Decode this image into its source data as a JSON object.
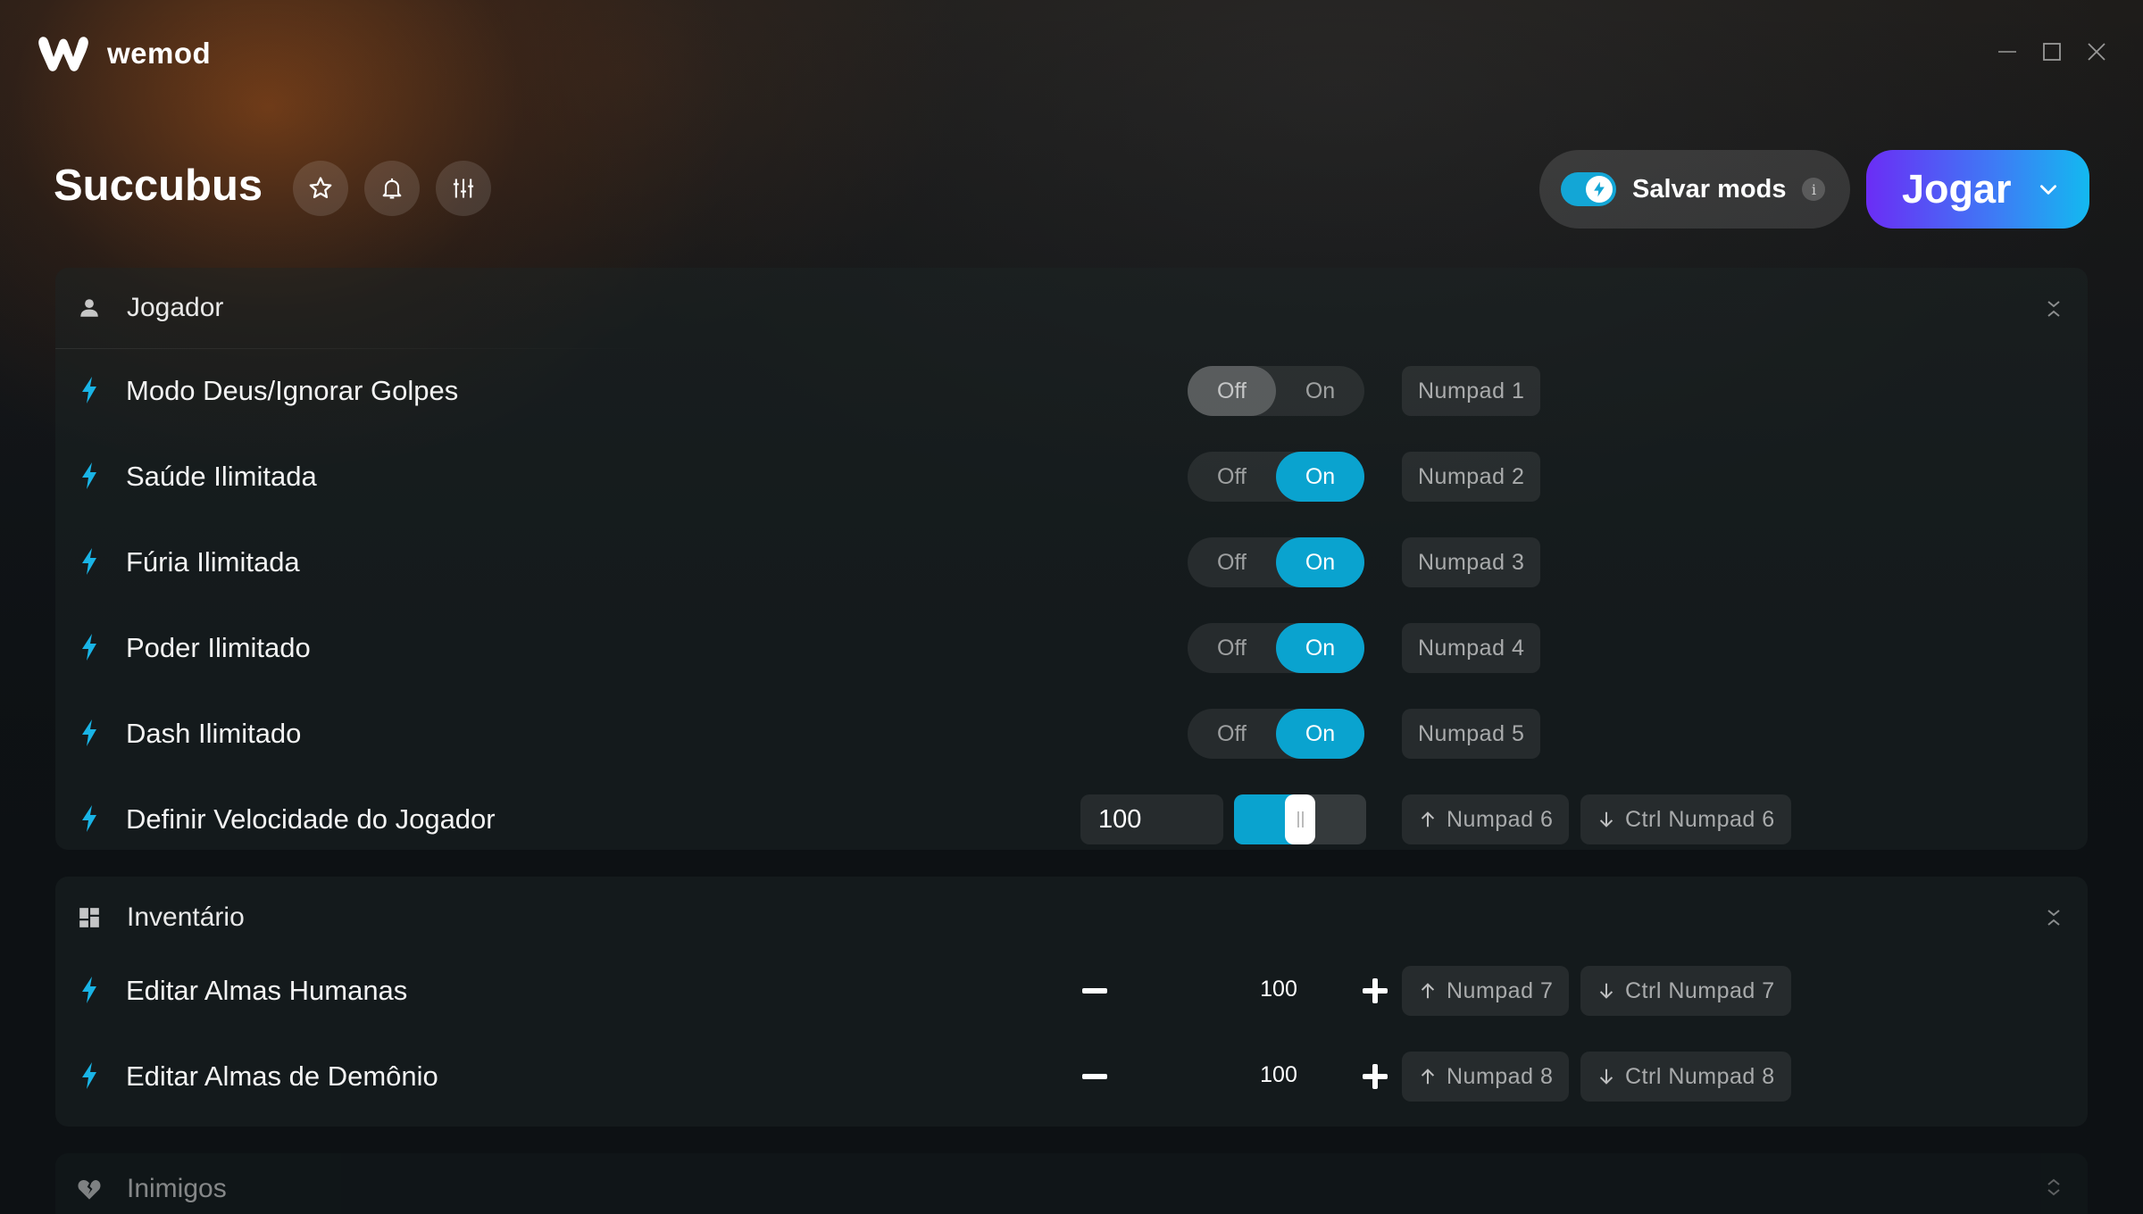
{
  "app": {
    "name": "wemod"
  },
  "game": {
    "title": "Succubus"
  },
  "header": {
    "save_mods_label": "Salvar mods",
    "save_mods_enabled": true,
    "info_label": "i",
    "play_label": "Jogar"
  },
  "toggle_labels": {
    "off": "Off",
    "on": "On"
  },
  "colors": {
    "accent": "#0aa3cf",
    "play_gradient": [
      "#6b2df5",
      "#13b9f0"
    ]
  },
  "sections": [
    {
      "title": "Jogador",
      "icon": "person-icon",
      "mods": [
        {
          "label": "Modo Deus/Ignorar Golpes",
          "type": "toggle",
          "state": "Off",
          "hotkeys": [
            "Numpad 1"
          ]
        },
        {
          "label": "Saúde Ilimitada",
          "type": "toggle",
          "state": "On",
          "hotkeys": [
            "Numpad 2"
          ]
        },
        {
          "label": "Fúria Ilimitada",
          "type": "toggle",
          "state": "On",
          "hotkeys": [
            "Numpad 3"
          ]
        },
        {
          "label": "Poder Ilimitado",
          "type": "toggle",
          "state": "On",
          "hotkeys": [
            "Numpad 4"
          ]
        },
        {
          "label": "Dash Ilimitado",
          "type": "toggle",
          "state": "On",
          "hotkeys": [
            "Numpad 5"
          ]
        },
        {
          "label": "Definir Velocidade do Jogador",
          "type": "slider",
          "value": "100",
          "slider_fraction": 0.5,
          "hotkeys": [
            "Numpad 6",
            "Ctrl Numpad 6"
          ]
        }
      ]
    },
    {
      "title": "Inventário",
      "icon": "dashboard-icon",
      "mods": [
        {
          "label": "Editar Almas Humanas",
          "type": "stepper",
          "value": "100",
          "hotkeys": [
            "Numpad 7",
            "Ctrl Numpad 7"
          ]
        },
        {
          "label": "Editar Almas de Demônio",
          "type": "stepper",
          "value": "100",
          "hotkeys": [
            "Numpad 8",
            "Ctrl Numpad 8"
          ]
        }
      ]
    },
    {
      "title": "Inimigos",
      "icon": "broken-heart-icon",
      "mods": []
    }
  ]
}
